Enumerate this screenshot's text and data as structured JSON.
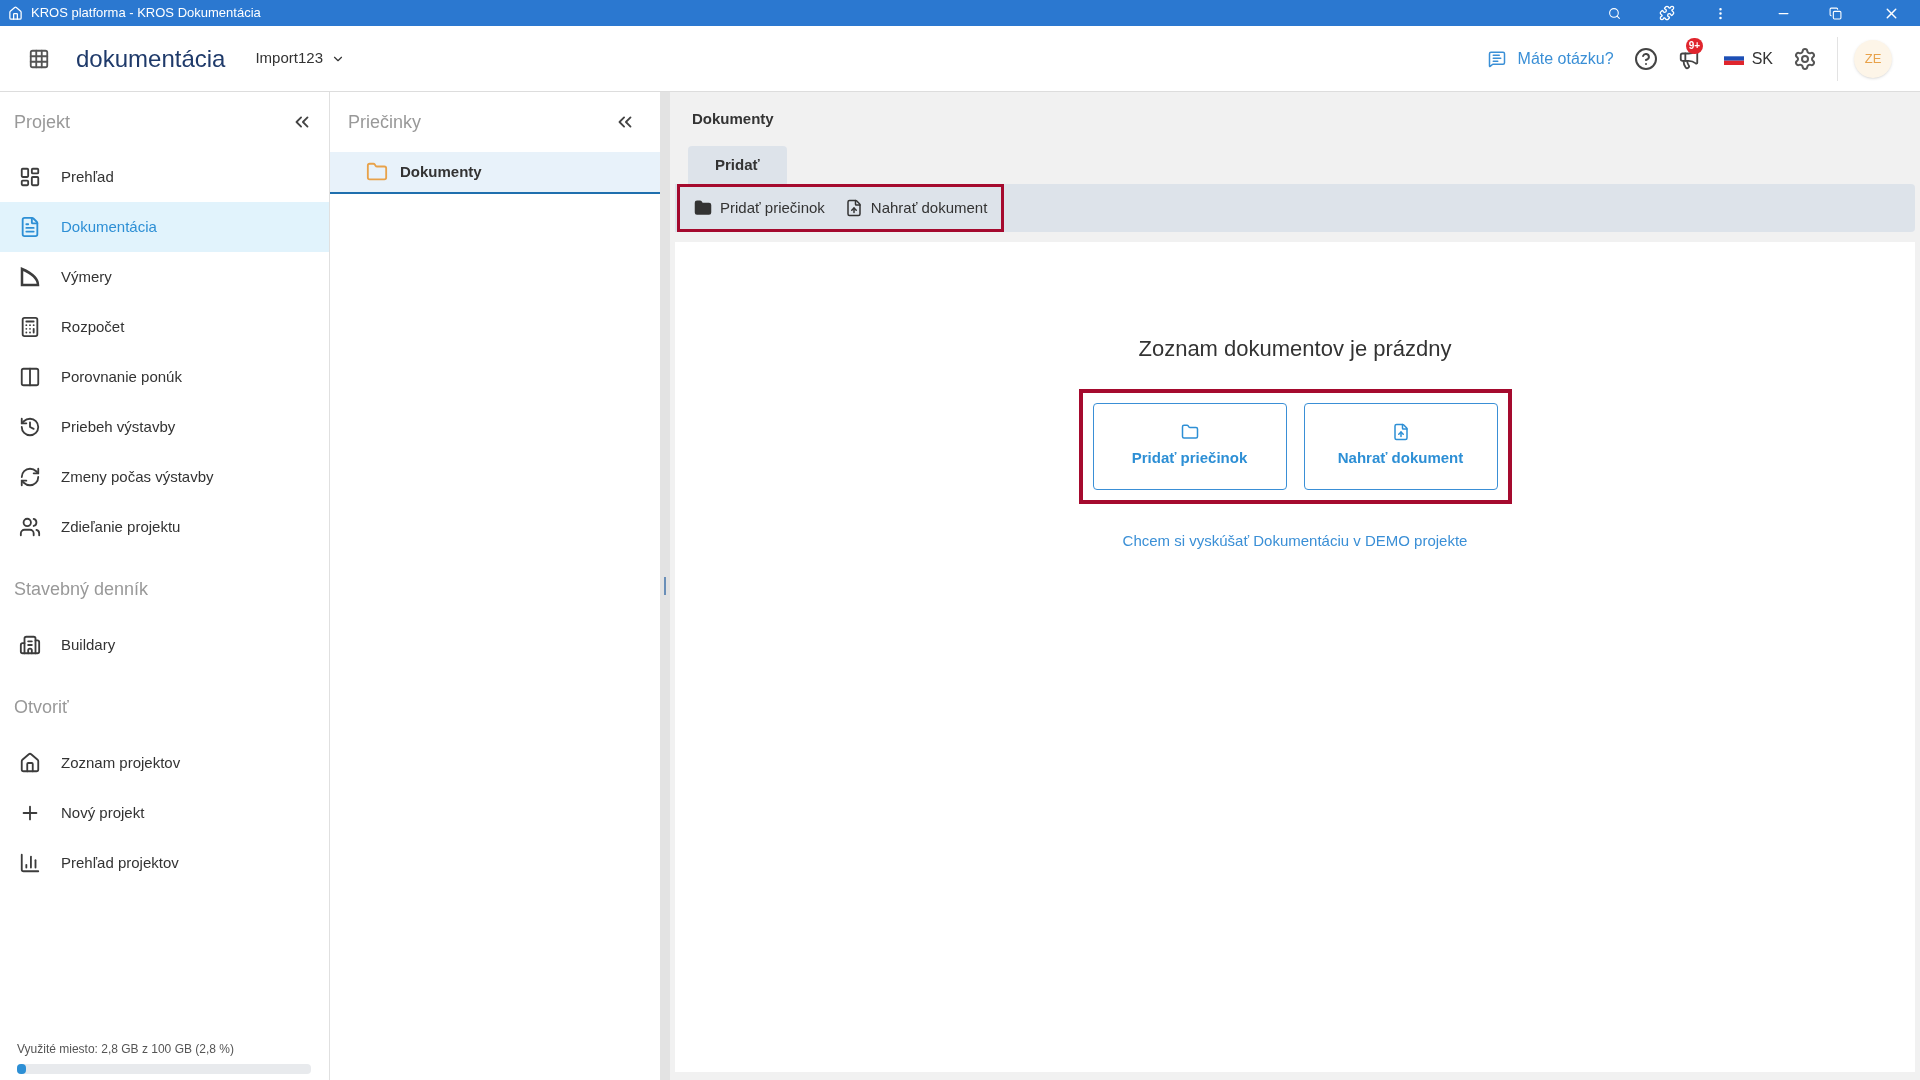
{
  "title_bar": {
    "title": "KROS platforma - KROS Dokumentácia"
  },
  "header": {
    "app_name": "dokumentácia",
    "project": "Import123",
    "question": "Máte otázku?",
    "notification_badge": "9+",
    "language": "SK",
    "avatar": "ZE"
  },
  "sidebar": {
    "groups": [
      {
        "title": "Projekt",
        "items": [
          {
            "label": "Prehľad",
            "selected": false
          },
          {
            "label": "Dokumentácia",
            "selected": true
          },
          {
            "label": "Výmery",
            "selected": false
          },
          {
            "label": "Rozpočet",
            "selected": false
          },
          {
            "label": "Porovnanie ponúk",
            "selected": false
          },
          {
            "label": "Priebeh výstavby",
            "selected": false
          },
          {
            "label": "Zmeny počas výstavby",
            "selected": false
          },
          {
            "label": "Zdieľanie projektu",
            "selected": false
          }
        ]
      },
      {
        "title": "Stavebný denník",
        "items": [
          {
            "label": "Buildary",
            "selected": false
          }
        ]
      },
      {
        "title": "Otvoriť",
        "items": [
          {
            "label": "Zoznam projektov",
            "selected": false
          },
          {
            "label": "Nový projekt",
            "selected": false
          },
          {
            "label": "Prehľad projektov",
            "selected": false
          }
        ]
      }
    ],
    "storage": {
      "label": "Využité miesto: 2,8 GB z 100 GB (2,8 %)",
      "level": 0.028
    }
  },
  "folders": {
    "title": "Priečinky",
    "items": [
      {
        "label": "Dokumenty",
        "selected": true
      }
    ]
  },
  "main": {
    "breadcrumb": "Dokumenty",
    "tabs": [
      {
        "label": "Pridať",
        "selected": true
      }
    ],
    "toolbar": [
      "Pridať priečinok",
      "Nahrať dokument"
    ],
    "empty_title": "Zoznam dokumentov je prázdny",
    "actions": [
      "Pridať priečinok",
      "Nahrať dokument"
    ],
    "demo_link": "Chcem si vyskúšať Dokumentáciu v DEMO projekte"
  }
}
